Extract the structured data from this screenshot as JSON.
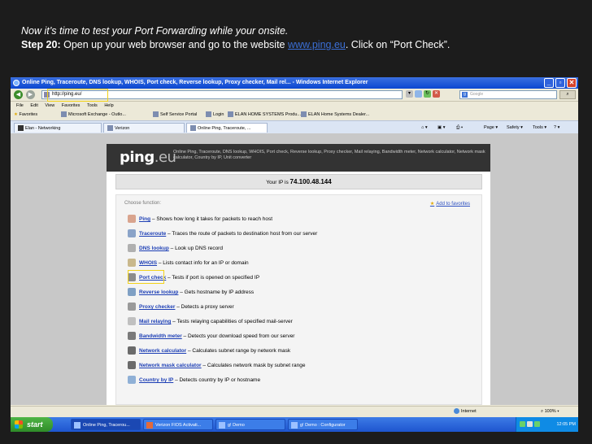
{
  "slide": {
    "intro": "Now it’s time to test your Port Forwarding while your onsite.",
    "step_label": "Step 20:",
    "step_pre": " Open up your web browser and go to the website ",
    "step_link": "www.ping.eu",
    "step_post": ".  Click on “Port Check”."
  },
  "browser": {
    "window_title": "Online Ping, Traceroute, DNS lookup, WHOIS, Port check, Reverse lookup, Proxy checker, Mail rel... - Windows Internet Explorer",
    "address": "http://ping.eu/",
    "search_placeholder": "Google",
    "menu": [
      "File",
      "Edit",
      "View",
      "Favorites",
      "Tools",
      "Help"
    ],
    "favorites_label": "Favorites",
    "favorites": [
      "Microsoft Exchange - Outlo...",
      "Self Service Portal",
      "Login",
      "ELAN HOME SYSTEMS Produ...",
      "ELAN Home Systems Dealer..."
    ],
    "tabs": [
      "Elan - Networking",
      "Verizon",
      "Online Ping, Traceroute, ..."
    ],
    "commands": [
      "Page ▾",
      "Safety ▾",
      "Tools ▾"
    ],
    "status_zone": "Internet",
    "zoom": "100%"
  },
  "site": {
    "logo_main": "ping",
    "logo_tld": ".eu",
    "description": "Online Ping, Traceroute, DNS lookup, WHOIS, Port check, Reverse lookup, Proxy checker, Mail relaying, Bandwidth meter, Network calculator, Network mask calculator, Country by IP, Unit converter",
    "ip_label": "Your IP is",
    "ip": "74.100.48.144",
    "choose_label": "Choose function:",
    "add_favorites": "Add to favorites",
    "functions": [
      {
        "name": "Ping",
        "desc": " – Shows how long it takes for packets to reach host"
      },
      {
        "name": "Traceroute",
        "desc": " – Traces the route of packets to destination host from our server"
      },
      {
        "name": "DNS lookup",
        "desc": " – Look up DNS record"
      },
      {
        "name": "WHOIS",
        "desc": " – Lists contact info for an IP or domain"
      },
      {
        "name": "Port check",
        "desc": " – Tests if port is opened on specified IP"
      },
      {
        "name": "Reverse lookup",
        "desc": " – Gets hostname by IP address"
      },
      {
        "name": "Proxy checker",
        "desc": " – Detects a proxy server"
      },
      {
        "name": "Mail relaying",
        "desc": " – Tests relaying capabilities of specified mail-server"
      },
      {
        "name": "Bandwidth meter",
        "desc": " – Detects your download speed from our server"
      },
      {
        "name": "Network calculator",
        "desc": " – Calculates subnet range by network mask"
      },
      {
        "name": "Network mask calculator",
        "desc": " – Calculates network mask by subnet range"
      },
      {
        "name": "Country by IP",
        "desc": " – Detects country by IP or hostname"
      }
    ]
  },
  "taskbar": {
    "start": "start",
    "tasks": [
      "Online Ping, Tracerou...",
      "Verizon FIOS Activati...",
      "g! Demo",
      "g! Demo : Configurator"
    ],
    "clock": "12:05 PM"
  },
  "colors": {
    "highlight": "#f2d21a",
    "link": "#1d3fb5",
    "xp_blue": "#0b47d1"
  }
}
